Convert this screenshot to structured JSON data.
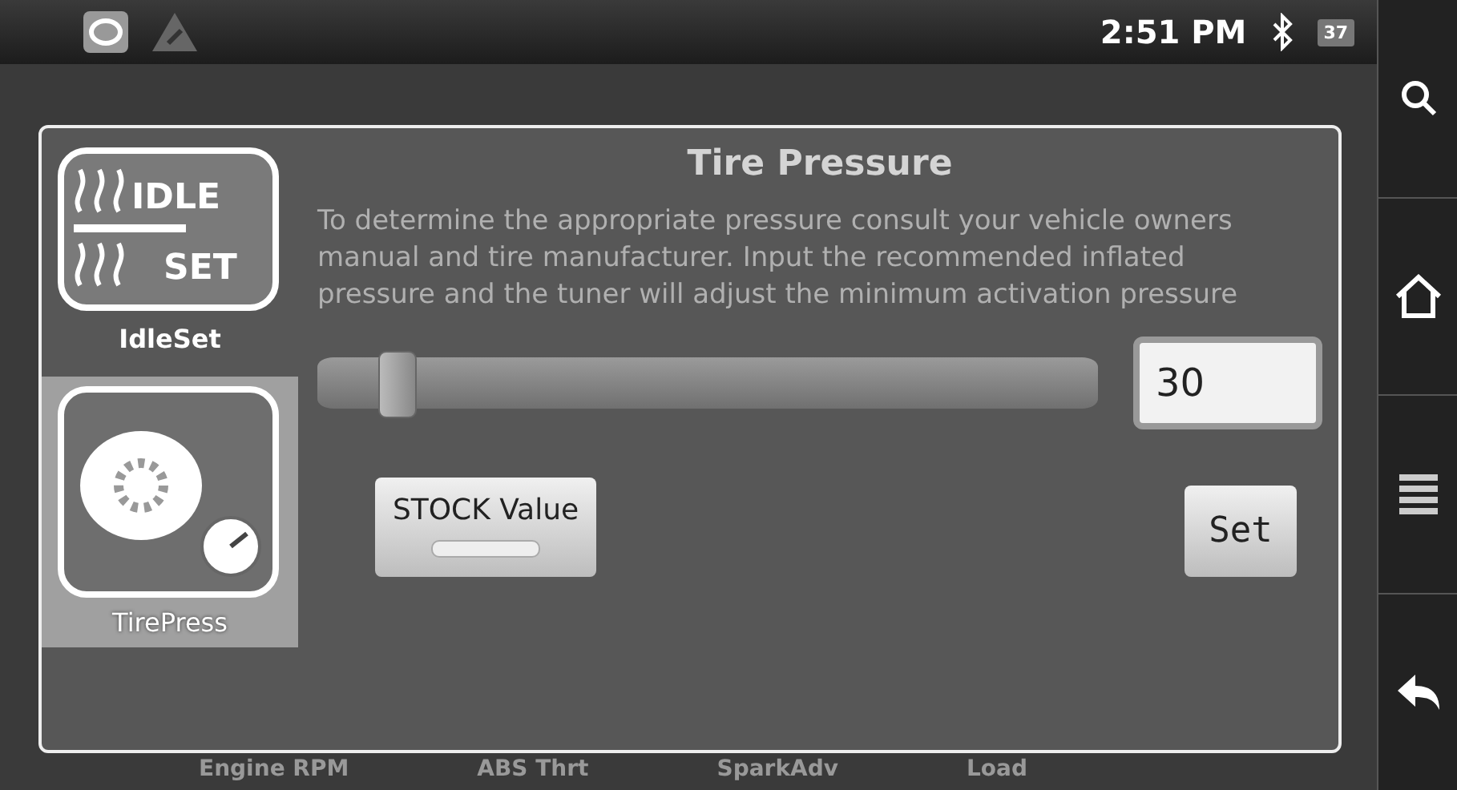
{
  "status_bar": {
    "time": "2:51 PM",
    "battery": "37"
  },
  "dialog": {
    "title": "Tire Pressure",
    "apps": [
      {
        "label": "IdleSet",
        "kind": "idle",
        "selected": false,
        "icon_text": [
          "IDLE",
          "SET"
        ]
      },
      {
        "label": "TirePress",
        "kind": "tire",
        "selected": true
      }
    ],
    "description": "To determine the appropriate pressure consult your vehicle owners manual and tire manufacturer. Input the recommended inflated pressure and the tuner will adjust the minimum activation pressure",
    "slider": {
      "level": 0.1
    },
    "pressure_input": {
      "value": "30"
    },
    "buttons": [
      {
        "label": "STOCK Value",
        "kind": "stock"
      },
      {
        "label": "Set",
        "kind": "set"
      }
    ]
  },
  "gauge_labels": [
    "Engine RPM",
    "ABS Thrt",
    "SparkAdv",
    "Load"
  ]
}
